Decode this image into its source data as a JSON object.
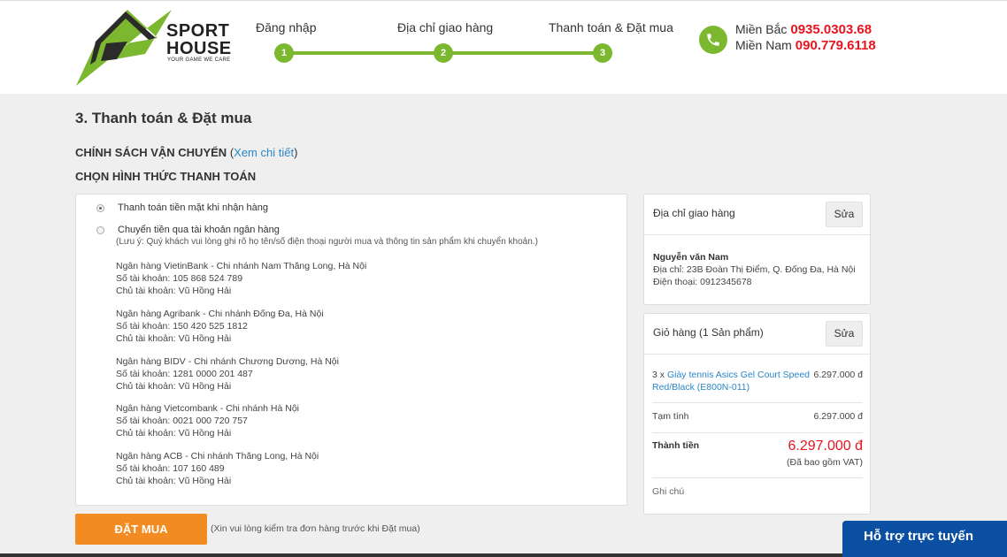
{
  "brand": {
    "name_line1": "SPORT",
    "name_line2": "HOUSE",
    "tagline": "YOUR GAME WE CARE",
    "accent": "#7cb82f"
  },
  "steps": [
    {
      "label": "Đăng nhập",
      "number": "1"
    },
    {
      "label": "Địa chỉ giao hàng",
      "number": "2"
    },
    {
      "label": "Thanh toán & Đặt mua",
      "number": "3"
    }
  ],
  "hotline": {
    "north_label": "Miền Bắc",
    "north_number": "0935.0303.68",
    "south_label": "Miền Nam",
    "south_number": "090.779.6118"
  },
  "page_title": "3. Thanh toán & Đặt mua",
  "shipping_policy": {
    "heading": "CHÍNH SÁCH VẬN CHUYỂN",
    "link": "Xem chi tiết"
  },
  "payment_heading": "CHỌN HÌNH THỨC THANH TOÁN",
  "payment": {
    "cod_label": "Thanh toán tiền mặt khi nhận hàng",
    "bank_label": "Chuyển tiền qua tài khoản ngân hàng",
    "note": "(Lưu ý: Quý khách vui lòng ghi rõ họ tên/số điện thoại người mua và thông tin sản phẩm khi chuyển khoản.)",
    "banks": [
      {
        "name": "Ngân hàng VietinBank - Chi nhánh Nam Thăng Long, Hà Nội",
        "account": "Số tài khoản: 105 868 524 789",
        "holder": "Chủ tài khoản: Vũ Hồng Hải"
      },
      {
        "name": "Ngân hàng Agribank - Chi nhánh Đống Đa, Hà Nội",
        "account": "Số tài khoản: 150 420 525 1812",
        "holder": "Chủ tài khoản: Vũ Hồng Hải"
      },
      {
        "name": "Ngân hàng BIDV - Chi nhánh Chương Dương, Hà Nội",
        "account": "Số tài khoản: 1281 0000 201 487",
        "holder": "Chủ tài khoản: Vũ Hồng Hải"
      },
      {
        "name": "Ngân hàng Vietcombank - Chi nhánh Hà Nội",
        "account": "Số tài khoản: 0021 000 720 757",
        "holder": "Chủ tài khoản: Vũ Hồng Hải"
      },
      {
        "name": "Ngân hàng ACB - Chi nhánh Thăng Long, Hà Nội",
        "account": "Số tài khoản: 107 160 489",
        "holder": "Chủ tài khoản: Vũ Hồng Hải"
      }
    ]
  },
  "address_card": {
    "title": "Địa chỉ giao hàng",
    "edit_label": "Sửa",
    "name": "Nguyễn văn Nam",
    "address": "Địa chỉ: 23B Đoàn Thị Điểm, Q. Đống Đa, Hà Nội",
    "phone": "Điện thoại: 0912345678"
  },
  "cart_card": {
    "title": "Giỏ hàng (1 Sản phẩm)",
    "edit_label": "Sửa",
    "item_qty": "3 x",
    "item_name_line1": "Giày tennis Asics Gel Court Speed",
    "item_name_line2": "Red/Black (E800N-011)",
    "item_price": "6.297.000 đ",
    "subtotal_label": "Tạm tính",
    "subtotal_value": "6.297.000 đ",
    "total_label": "Thành tiền",
    "total_value": "6.297.000 đ",
    "vat_note": "(Đã bao gồm VAT)",
    "notes_label": "Ghi chú"
  },
  "order_button": "ĐẶT MUA",
  "order_note": "(Xin vui lòng kiểm tra đơn hàng trước khi Đặt mua)",
  "support_label": "Hỗ trợ trực tuyến",
  "colors": {
    "link": "#2a86c8",
    "price": "#e8141f",
    "order_button": "#f28b22",
    "support": "#0b4fa3"
  }
}
